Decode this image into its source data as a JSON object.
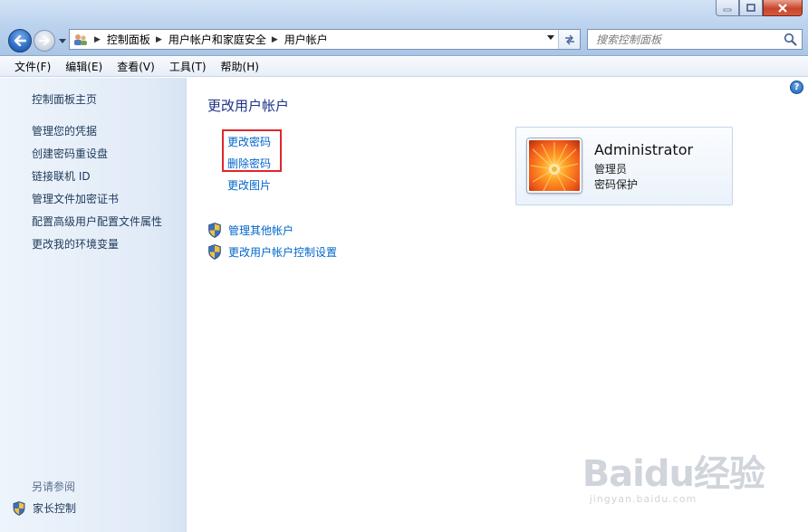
{
  "window": {
    "controls": [
      "minimize",
      "maximize",
      "close"
    ]
  },
  "address": {
    "crumbs": [
      "控制面板",
      "用户帐户和家庭安全",
      "用户帐户"
    ]
  },
  "search": {
    "placeholder": "搜索控制面板"
  },
  "menu": [
    "文件(F)",
    "编辑(E)",
    "查看(V)",
    "工具(T)",
    "帮助(H)"
  ],
  "sidebar": {
    "home": "控制面板主页",
    "links": [
      "管理您的凭据",
      "创建密码重设盘",
      "链接联机 ID",
      "管理文件加密证书",
      "配置高级用户配置文件属性",
      "更改我的环境变量"
    ],
    "see_also": "另请参阅",
    "parental": "家长控制"
  },
  "main": {
    "heading": "更改用户帐户",
    "tasks": [
      "更改密码",
      "删除密码",
      "更改图片"
    ],
    "shield_tasks": [
      "管理其他帐户",
      "更改用户帐户控制设置"
    ],
    "help": "?"
  },
  "account": {
    "name": "Administrator",
    "role": "管理员",
    "status": "密码保护"
  },
  "watermark": {
    "main": "Baidu经验",
    "sub": "jingyan.baidu.com"
  },
  "colors": {
    "link": "#0066cc",
    "heading": "#1e3287",
    "highlight_box": "#e0262b"
  }
}
